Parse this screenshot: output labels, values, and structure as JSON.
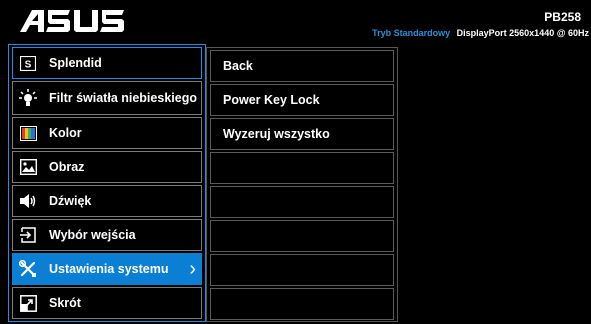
{
  "header": {
    "brand": "ASUS",
    "model": "PB258",
    "mode": "Tryb Standardowy",
    "info": "DisplayPort  2560x1440 @ 60Hz"
  },
  "main_menu": {
    "items": [
      {
        "label": "Splendid",
        "icon": "splendid-s-icon"
      },
      {
        "label": "Filtr światła niebieskiego",
        "icon": "blue-light-bulb-icon"
      },
      {
        "label": "Kolor",
        "icon": "color-bars-icon"
      },
      {
        "label": "Obraz",
        "icon": "image-icon"
      },
      {
        "label": "Dźwięk",
        "icon": "speaker-icon"
      },
      {
        "label": "Wybór wejścia",
        "icon": "input-select-icon"
      },
      {
        "label": "Ustawienia systemu",
        "icon": "wrench-screwdriver-icon",
        "active": true
      },
      {
        "label": "Skrót",
        "icon": "shortcut-icon"
      }
    ]
  },
  "sub_menu": {
    "items": [
      "Back",
      "Power Key Lock",
      "Wyzeruj wszystko",
      "",
      "",
      "",
      "",
      ""
    ]
  },
  "colors": {
    "accent": "#0a7fd3",
    "mode_text": "#2a8fd6"
  }
}
